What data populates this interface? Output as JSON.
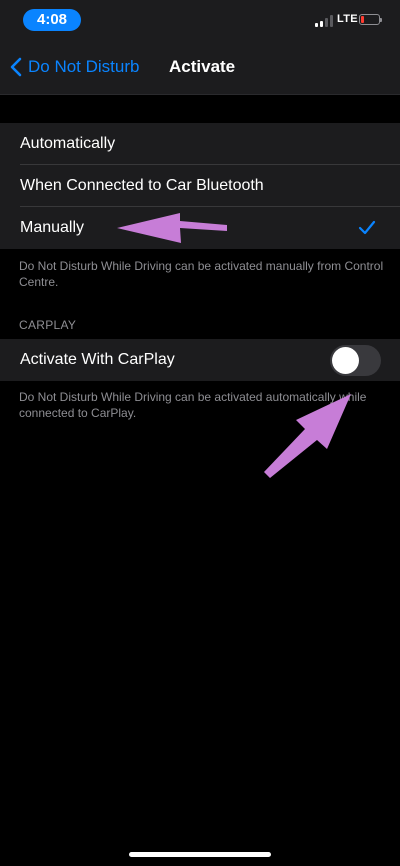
{
  "status_bar": {
    "time": "4:08",
    "network": "LTE",
    "signal_bars": 2,
    "battery_color": "#ff3b30"
  },
  "nav": {
    "back_label": "Do Not Disturb",
    "title": "Activate",
    "accent_color": "#0a84ff"
  },
  "activate_options": [
    {
      "label": "Automatically",
      "selected": false
    },
    {
      "label": "When Connected to Car Bluetooth",
      "selected": false
    },
    {
      "label": "Manually",
      "selected": true
    }
  ],
  "activate_footer": "Do Not Disturb While Driving can be activated manually from Control Centre.",
  "carplay": {
    "header": "CARPLAY",
    "toggle_label": "Activate With CarPlay",
    "toggle_on": false,
    "footer": "Do Not Disturb While Driving can be activated automatically while connected to CarPlay."
  },
  "annotations": {
    "arrow_color": "#c77dd7",
    "icons": [
      "arrow-left-icon",
      "arrow-up-right-icon"
    ]
  }
}
